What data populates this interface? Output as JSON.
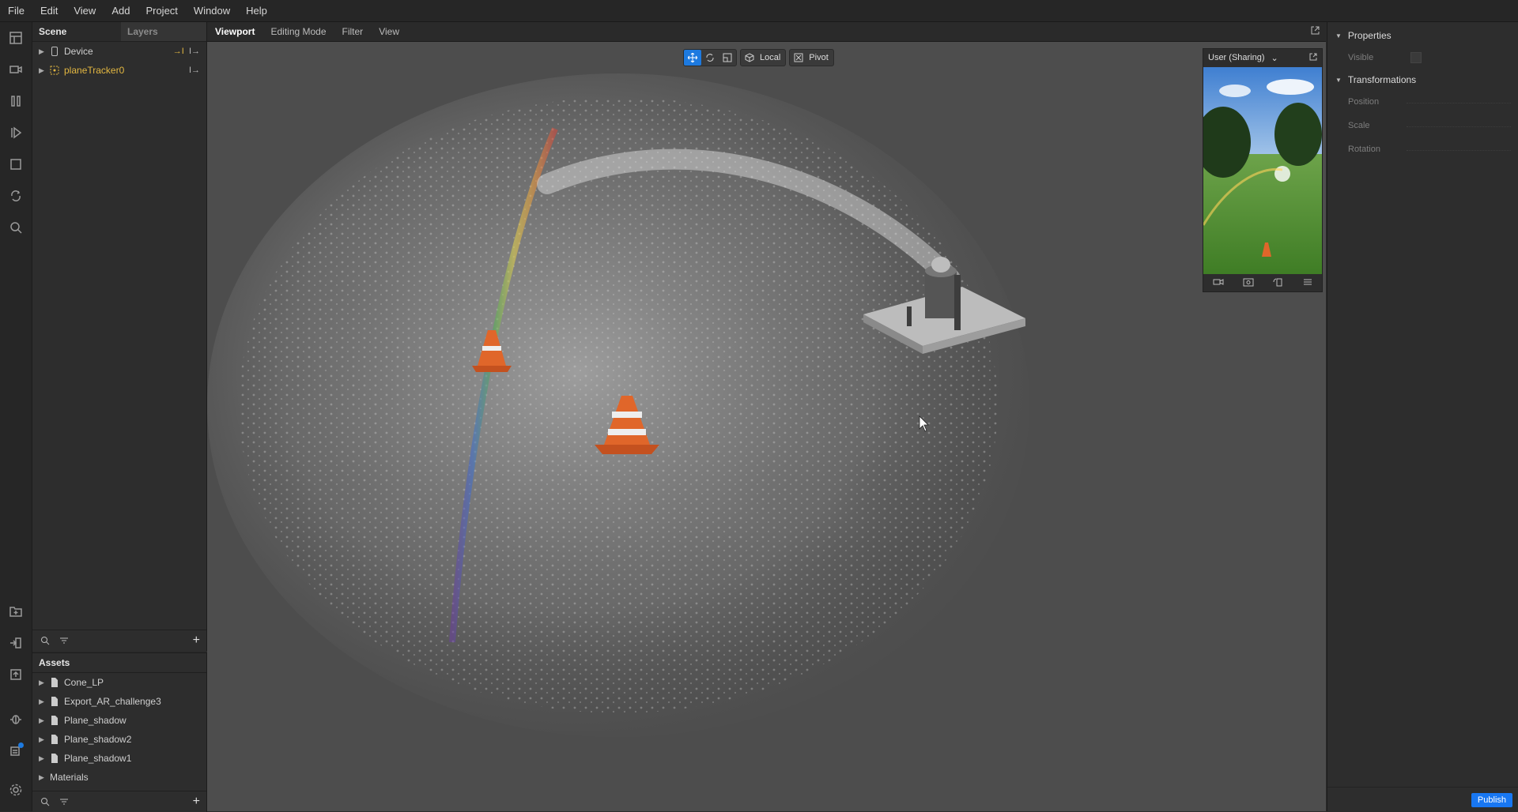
{
  "menu": [
    "File",
    "Edit",
    "View",
    "Add",
    "Project",
    "Window",
    "Help"
  ],
  "scene_panel": {
    "tab_scene": "Scene",
    "tab_layers": "Layers",
    "items": [
      {
        "label": "Device",
        "right": "→I  I→"
      },
      {
        "label": "planeTracker0",
        "right": "I→"
      }
    ]
  },
  "assets_panel": {
    "title": "Assets",
    "items": [
      {
        "label": "Cone_LP"
      },
      {
        "label": "Export_AR_challenge3"
      },
      {
        "label": "Plane_shadow"
      },
      {
        "label": "Plane_shadow2"
      },
      {
        "label": "Plane_shadow1"
      },
      {
        "label": "Materials"
      }
    ]
  },
  "viewport_bar": {
    "tabs": [
      "Viewport",
      "Editing Mode",
      "Filter",
      "View"
    ]
  },
  "toolbar": {
    "local": "Local",
    "pivot": "Pivot"
  },
  "preview": {
    "title": "User (Sharing)"
  },
  "properties": {
    "section1": "Properties",
    "visible": "Visible",
    "section2": "Transformations",
    "position": "Position",
    "scale": "Scale",
    "rotation": "Rotation",
    "publish": "Publish"
  },
  "colors": {
    "accent": "#1d7ae0",
    "tracker": "#e3b741",
    "publish": "#1877f2"
  }
}
